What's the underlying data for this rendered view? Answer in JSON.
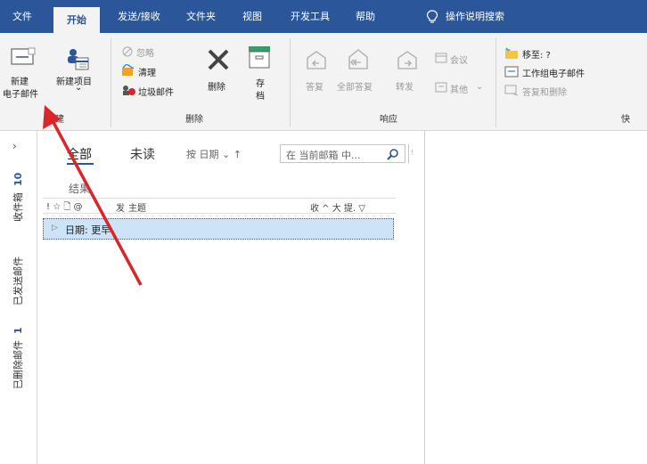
{
  "tabs": [
    {
      "label": "文件",
      "active": false
    },
    {
      "label": "开始",
      "active": true
    },
    {
      "label": "发送/接收",
      "active": false
    },
    {
      "label": "文件夹",
      "active": false
    },
    {
      "label": "视图",
      "active": false
    },
    {
      "label": "开发工具",
      "active": false
    },
    {
      "label": "帮助",
      "active": false
    }
  ],
  "tell_me": "操作说明搜索",
  "ribbon": {
    "new_group": {
      "new_email_line1": "新建",
      "new_email_line2": "电子邮件",
      "new_items": "新建项目",
      "new_items_arrow": "⌄",
      "label": "新建"
    },
    "delete_group": {
      "ignore": "忽略",
      "cleanup": "清理",
      "junk": "垃圾邮件",
      "delete": "删除",
      "archive_line1": "存",
      "archive_line2": "档",
      "label": "删除"
    },
    "respond_group": {
      "reply": "答复",
      "reply_all": "全部答复",
      "forward": "转发",
      "meeting": "会议",
      "more": "其他",
      "label": "响应"
    },
    "quick_steps_group": {
      "move_to": "移至: ?",
      "team_email": "工作组电子邮件",
      "reply_delete": "答复和删除",
      "label": "快"
    }
  },
  "folders": [
    {
      "name": "收件箱",
      "count": "10"
    },
    {
      "name": "已发送邮件",
      "count": ""
    },
    {
      "name": "已删除邮件",
      "count": "1"
    }
  ],
  "list": {
    "filter_all": "全部",
    "filter_unread": "未读",
    "sort": "按 日期 ⌄  ↑",
    "search_placeholder": "在 当前邮箱 中...",
    "results": "结果",
    "col_flags": "! ☆ 🗋 @",
    "col_from": "发",
    "col_subject": "主题",
    "col_right": "收 ^ 大 提. ▽",
    "group_row": "日期: 更早"
  },
  "colors": {
    "accent": "#2b579a",
    "arrow": "#d9262b",
    "selection": "#cde3f7"
  }
}
